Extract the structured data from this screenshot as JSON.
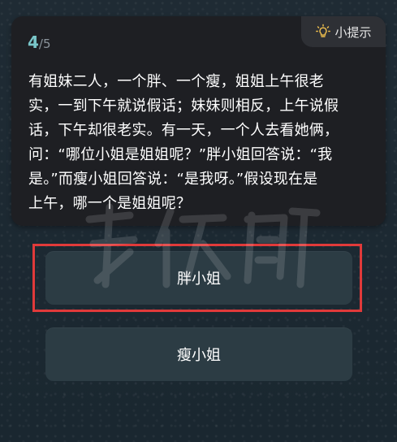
{
  "progress": {
    "current": "4",
    "separator": "/",
    "total": "5"
  },
  "hint": {
    "icon": "lightbulb-icon",
    "label": "小提示"
  },
  "question": {
    "text": "有姐妹二人，一个胖、一个瘦，姐姐上午很老\n实，一到下午就说假话；妹妹则相反，上午说假\n话，下午却很老实。有一天，一个人去看她俩，\n问：“哪位小姐是姐姐呢？”胖小姐回答说：“我\n是。”而瘦小姐回答说：“是我呀。”假设现在是\n上午，哪一个是姐姐呢？"
  },
  "answers": [
    {
      "label": "胖小姐",
      "highlighted": true
    },
    {
      "label": "瘦小姐",
      "highlighted": false
    }
  ],
  "colors": {
    "progress_current": "#79c6c9",
    "highlight": "#e13a3a",
    "answer_bg": "#2c3c44",
    "card_bg": "#1e1f23"
  }
}
